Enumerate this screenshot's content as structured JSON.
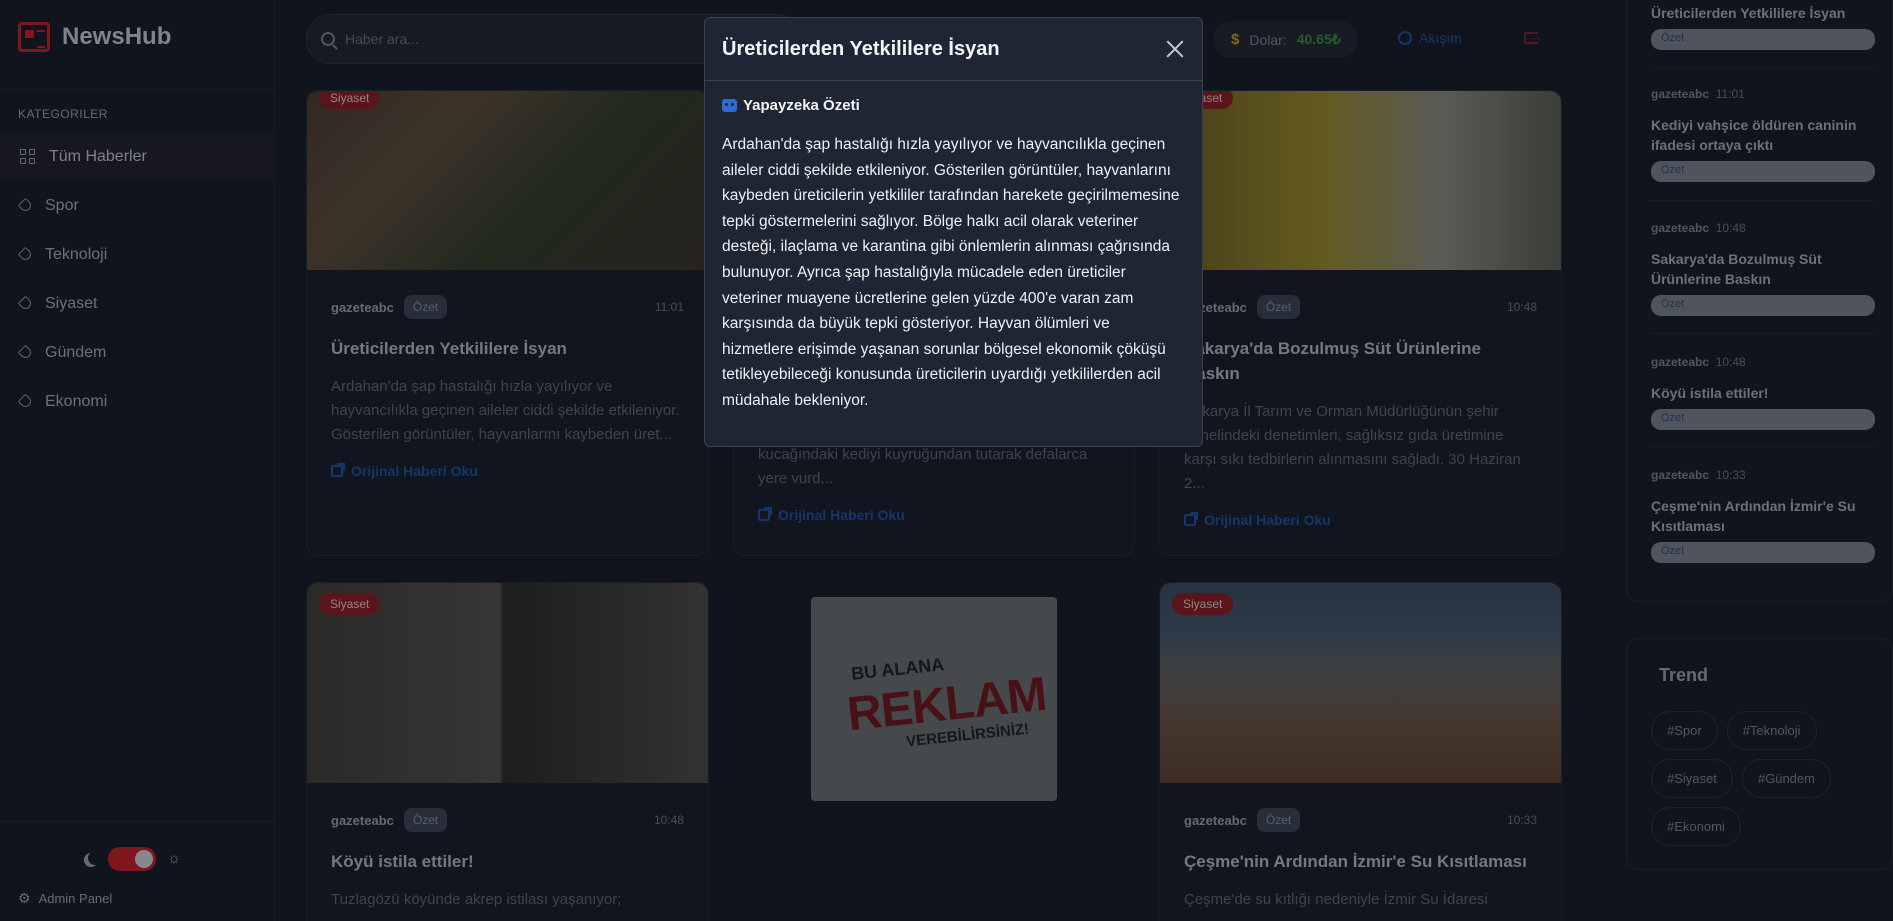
{
  "app": {
    "name": "NewsHub"
  },
  "sidebar": {
    "section_title": "KATEGORILER",
    "items": [
      {
        "label": "Tüm Haberler",
        "active": true
      },
      {
        "label": "Spor"
      },
      {
        "label": "Teknoloji"
      },
      {
        "label": "Siyaset"
      },
      {
        "label": "Gündem"
      },
      {
        "label": "Ekonomi"
      }
    ],
    "admin_label": "Admin Panel"
  },
  "header": {
    "search_placeholder": "Haber ara...",
    "dollar_label": "Dolar:",
    "dollar_value": "40.65₺",
    "user_label": "Akışım"
  },
  "cards": [
    {
      "category": "Siyaset",
      "source": "gazeteabc",
      "badge": "Özet",
      "time": "11:01",
      "title": "Üreticilerden Yetkililere İsyan",
      "desc": "Ardahan'da şap hastalığı hızla yayılıyor ve hayvancılıkla geçinen aileler ciddi şekilde etkileniyor. Gösterilen görüntüler, hayvanlarını kaybeden üret...",
      "link": "Orijinal Haberi Oku"
    },
    {
      "desc": "kucağındaki kediyi kuyruğundan tutarak defalarca yere vurd...",
      "link": "Orijinal Haberi Oku"
    },
    {
      "category": "Siyaset",
      "source": "gazeteabc",
      "badge": "Özet",
      "time": "10:48",
      "title": "Sakarya'da Bozulmuş Süt Ürünlerine Baskın",
      "desc": "Sakarya İl Tarım ve Orman Müdürlüğünün şehir genelindeki denetimleri, sağlıksız gıda üretimine karşı sıkı tedbirlerin alınmasını sağladı. 30 Haziran 2...",
      "link": "Orijinal Haberi Oku"
    },
    {
      "category": "Siyaset",
      "source": "gazeteabc",
      "badge": "Özet",
      "time": "10:48",
      "title": "Köyü istila ettiler!",
      "desc": "Tuzlagözü köyünde akrep istilası yaşanıyor;"
    },
    {
      "category": "Siyaset",
      "source": "gazeteabc",
      "badge": "Özet",
      "time": "10:33",
      "title": "Çeşme'nin Ardından İzmir'e Su Kısıtlaması",
      "desc": "Çeşme'de su kıtlığı nedeniyle İzmir Su İdaresi"
    }
  ],
  "ad": {
    "line1": "BU ALANA",
    "line2": "REKLAM",
    "line3": "VEREBİLİRSİNİZ!"
  },
  "right_panel": {
    "items": [
      {
        "title": "Üreticilerden Yetkililere İsyan",
        "badge": "Özet"
      },
      {
        "source": "gazeteabc",
        "time": "11:01",
        "title": "Kediyi vahşice öldüren caninin ifadesi ortaya çıktı",
        "badge": "Özet"
      },
      {
        "source": "gazeteabc",
        "time": "10:48",
        "title": "Sakarya'da Bozulmuş Süt Ürünlerine Baskın",
        "badge": "Özet"
      },
      {
        "source": "gazeteabc",
        "time": "10:48",
        "title": "Köyü istila ettiler!",
        "badge": "Özet"
      },
      {
        "source": "gazeteabc",
        "time": "10:33",
        "title": "Çeşme'nin Ardından İzmir'e Su Kısıtlaması",
        "badge": "Özet"
      }
    ]
  },
  "trend": {
    "title": "Trend",
    "tags": [
      "#Spor",
      "#Teknoloji",
      "#Siyaset",
      "#Gündem",
      "#Ekonomi"
    ]
  },
  "modal": {
    "title": "Üreticilerden Yetkililere İsyan",
    "ai_label": "Yapayzeka Özeti",
    "text": "Ardahan'da şap hastalığı hızla yayılıyor ve hayvancılıkla geçinen aileler ciddi şekilde etkileniyor. Gösterilen görüntüler, hayvanlarını kaybeden üreticilerin yetkililer tarafından harekete geçirilmemesine tepki göstermelerini sağlıyor. Bölge halkı acil olarak veteriner desteği, ilaçlama ve karantina gibi önlemlerin alınması çağrısında bulunuyor. Ayrıca şap hastalığıyla mücadele eden üreticiler veteriner muayene ücretlerine gelen yüzde 400'e varan zam karşısında da büyük tepki gösteriyor. Hayvan ölümleri ve hizmetlere erişimde yaşanan sorunlar bölgesel ekonomik çöküşü tetikleyebileceği konusunda üreticilerin uyardığı yetkililerden acil müdahale bekleniyor."
  }
}
